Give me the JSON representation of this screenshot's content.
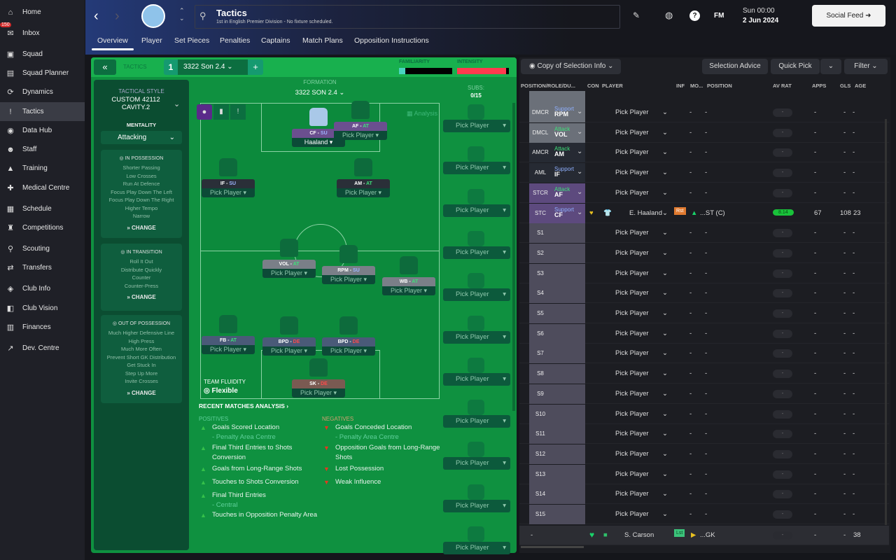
{
  "sidebar": {
    "items": [
      {
        "label": "Home",
        "icon": "home-icon",
        "g": "⌂"
      },
      {
        "label": "Inbox",
        "icon": "inbox-icon",
        "g": "✉",
        "badge": "150"
      },
      {
        "label": "Squad",
        "icon": "squad-icon",
        "g": "▣"
      },
      {
        "label": "Squad Planner",
        "icon": "squad-planner-icon",
        "g": "▤"
      },
      {
        "label": "Dynamics",
        "icon": "dynamics-icon",
        "g": "⟳"
      },
      {
        "label": "Tactics",
        "icon": "tactics-icon",
        "g": "!",
        "active": true
      },
      {
        "label": "Data Hub",
        "icon": "data-hub-icon",
        "g": "◉"
      },
      {
        "label": "Staff",
        "icon": "staff-icon",
        "g": "☻"
      },
      {
        "label": "Training",
        "icon": "training-icon",
        "g": "▲"
      },
      {
        "label": "Medical Centre",
        "icon": "medical-icon",
        "g": "✚"
      },
      {
        "label": "Schedule",
        "icon": "schedule-icon",
        "g": "▦"
      },
      {
        "label": "Competitions",
        "icon": "trophy-icon",
        "g": "♜"
      },
      {
        "label": "Scouting",
        "icon": "scouting-icon",
        "g": "⚲"
      },
      {
        "label": "Transfers",
        "icon": "transfers-icon",
        "g": "⇄"
      },
      {
        "label": "Club Info",
        "icon": "club-info-icon",
        "g": "◈"
      },
      {
        "label": "Club Vision",
        "icon": "club-vision-icon",
        "g": "◧"
      },
      {
        "label": "Finances",
        "icon": "finances-icon",
        "g": "▥"
      },
      {
        "label": "Dev. Centre",
        "icon": "dev-centre-icon",
        "g": "↗"
      }
    ]
  },
  "header": {
    "title": "Tactics",
    "subtitle": "1st in English Premier Division - No fixture scheduled.",
    "day": "Sun 00:00",
    "date": "2 Jun 2024",
    "social": "Social Feed",
    "fm": "FM",
    "tabs": [
      "Overview",
      "Player",
      "Set Pieces",
      "Penalties",
      "Captains",
      "Match Plans",
      "Opposition Instructions"
    ]
  },
  "strip": {
    "tactics": "TACTICS",
    "slot": "1",
    "tactic_name": "3322 Son 2.4",
    "familiarity": "FAMILIARITY",
    "intensity": "INTENSITY",
    "familiarity_level": 0.12,
    "intensity_level": 0.95
  },
  "style": {
    "label": "TACTICAL STYLE",
    "value": "CUSTOM 42112 CAVITY.2",
    "mentality_label": "MENTALITY",
    "mentality": "Attacking",
    "boxes": [
      {
        "title": "IN POSSESSION",
        "items": [
          "Shorter Passing",
          "Low Crosses",
          "Run At Defence",
          "Focus Play Down The Left",
          "Focus Play Down The Right",
          "Higher Tempo",
          "Narrow"
        ],
        "change": "CHANGE"
      },
      {
        "title": "IN TRANSITION",
        "items": [
          "Roll It Out",
          "Distribute Quickly",
          "Counter",
          "Counter-Press"
        ],
        "change": "CHANGE"
      },
      {
        "title": "OUT OF POSSESSION",
        "items": [
          "Much Higher Defensive Line",
          "High Press",
          "Much More Often",
          "Prevent Short GK Distribution",
          "Get Stuck In",
          "Step Up More",
          "Invite Crosses"
        ],
        "change": "CHANGE"
      }
    ]
  },
  "formation": {
    "label": "FORMATION",
    "name": "3322 SON 2.4",
    "subs_label": "SUBS:",
    "subs": "0/15",
    "analysis": "Analysis",
    "fluidity_label": "TEAM FLUIDITY",
    "fluidity": "Flexible",
    "players": [
      {
        "role": "CF",
        "duty": "SU",
        "player": "Haaland",
        "color": "#6b4f8f",
        "dc": "#9db4ff"
      },
      {
        "role": "AF",
        "duty": "AT",
        "player": "Pick Player",
        "color": "#6b4f8f",
        "dc": "#3ee07a"
      },
      {
        "role": "IF",
        "duty": "SU",
        "player": "Pick Player",
        "color": "#2a2f38",
        "dc": "#9db4ff"
      },
      {
        "role": "AM",
        "duty": "AT",
        "player": "Pick Player",
        "color": "#2a2f38",
        "dc": "#3ee07a"
      },
      {
        "role": "VOL",
        "duty": "AT",
        "player": "Pick Player",
        "color": "#7a7f88",
        "dc": "#3ee07a"
      },
      {
        "role": "RPM",
        "duty": "SU",
        "player": "Pick Player",
        "color": "#7a7f88",
        "dc": "#9db4ff"
      },
      {
        "role": "WB",
        "duty": "AT",
        "player": "Pick Player",
        "color": "#7a7f88",
        "dc": "#3ee07a"
      },
      {
        "role": "FB",
        "duty": "AT",
        "player": "Pick Player",
        "color": "#4a5a78",
        "dc": "#3ee07a"
      },
      {
        "role": "BPD",
        "duty": "DE",
        "player": "Pick Player",
        "color": "#4a5a78",
        "dc": "#ff4b4b"
      },
      {
        "role": "BPD",
        "duty": "DE",
        "player": "Pick Player",
        "color": "#4a5a78",
        "dc": "#ff4b4b"
      },
      {
        "role": "SK",
        "duty": "DE",
        "player": "Pick Player",
        "color": "#7a5a52",
        "dc": "#ff4b4b"
      }
    ],
    "sub_label": "Pick Player"
  },
  "analysis": {
    "title": "RECENT MATCHES ANALYSIS ›",
    "pos_label": "POSITIVES",
    "neg_label": "NEGATIVES",
    "positives": [
      {
        "t": "Goals Scored Location",
        "s": "- Penalty Area Centre"
      },
      {
        "t": "Final Third Entries to Shots Conversion"
      },
      {
        "t": "Goals from Long-Range Shots"
      },
      {
        "t": "Touches to Shots Conversion"
      },
      {
        "t": "Final Third Entries",
        "s": "- Central"
      },
      {
        "t": "Touches in Opposition Penalty Area"
      }
    ],
    "negatives": [
      {
        "t": "Goals Conceded Location",
        "s": "- Penalty Area Centre"
      },
      {
        "t": "Opposition Goals from Long-Range Shots"
      },
      {
        "t": "Lost Possession"
      },
      {
        "t": "Weak Influence"
      }
    ]
  },
  "selection": {
    "info": "Copy of Selection Info",
    "advice": "Selection Advice",
    "quick": "Quick Pick",
    "filter": "Filter",
    "columns": [
      "POSITION/ROLE/DU...",
      "CON",
      "PLAYER",
      "INF",
      "MO...",
      "POSITION",
      "AV RAT",
      "APPS",
      "GLS",
      "AGE"
    ],
    "rows": [
      {
        "pos": "DMCR",
        "role": "RPM",
        "duty": "Support",
        "player": "Pick Player",
        "bg": "#6b7079"
      },
      {
        "pos": "DMCL",
        "role": "VOL",
        "duty": "Attack",
        "player": "Pick Player",
        "bg": "#6b7079"
      },
      {
        "pos": "AMCR",
        "role": "AM",
        "duty": "Attack",
        "player": "Pick Player",
        "bg": "#262a33"
      },
      {
        "pos": "AML",
        "role": "IF",
        "duty": "Support",
        "player": "Pick Player",
        "bg": "#262a33"
      },
      {
        "pos": "STCR",
        "role": "AF",
        "duty": "Attack",
        "player": "Pick Player",
        "bg": "#5d4a7e"
      },
      {
        "pos": "STC",
        "role": "CF",
        "duty": "Support",
        "player": "E. Haaland",
        "bg": "#5d4a7e",
        "inf": "Rst",
        "position": "...ST (C)",
        "avrat": "8.14",
        "apps": "67",
        "gls": "108",
        "age": "23"
      }
    ],
    "subs": [
      "S1",
      "S2",
      "S3",
      "S4",
      "S5",
      "S6",
      "S7",
      "S8",
      "S9",
      "S10",
      "S11",
      "S12",
      "S13",
      "S14",
      "S15"
    ],
    "reserve": {
      "player": "S. Carson",
      "inf": "Lst",
      "position": "...GK",
      "age": "38"
    }
  }
}
